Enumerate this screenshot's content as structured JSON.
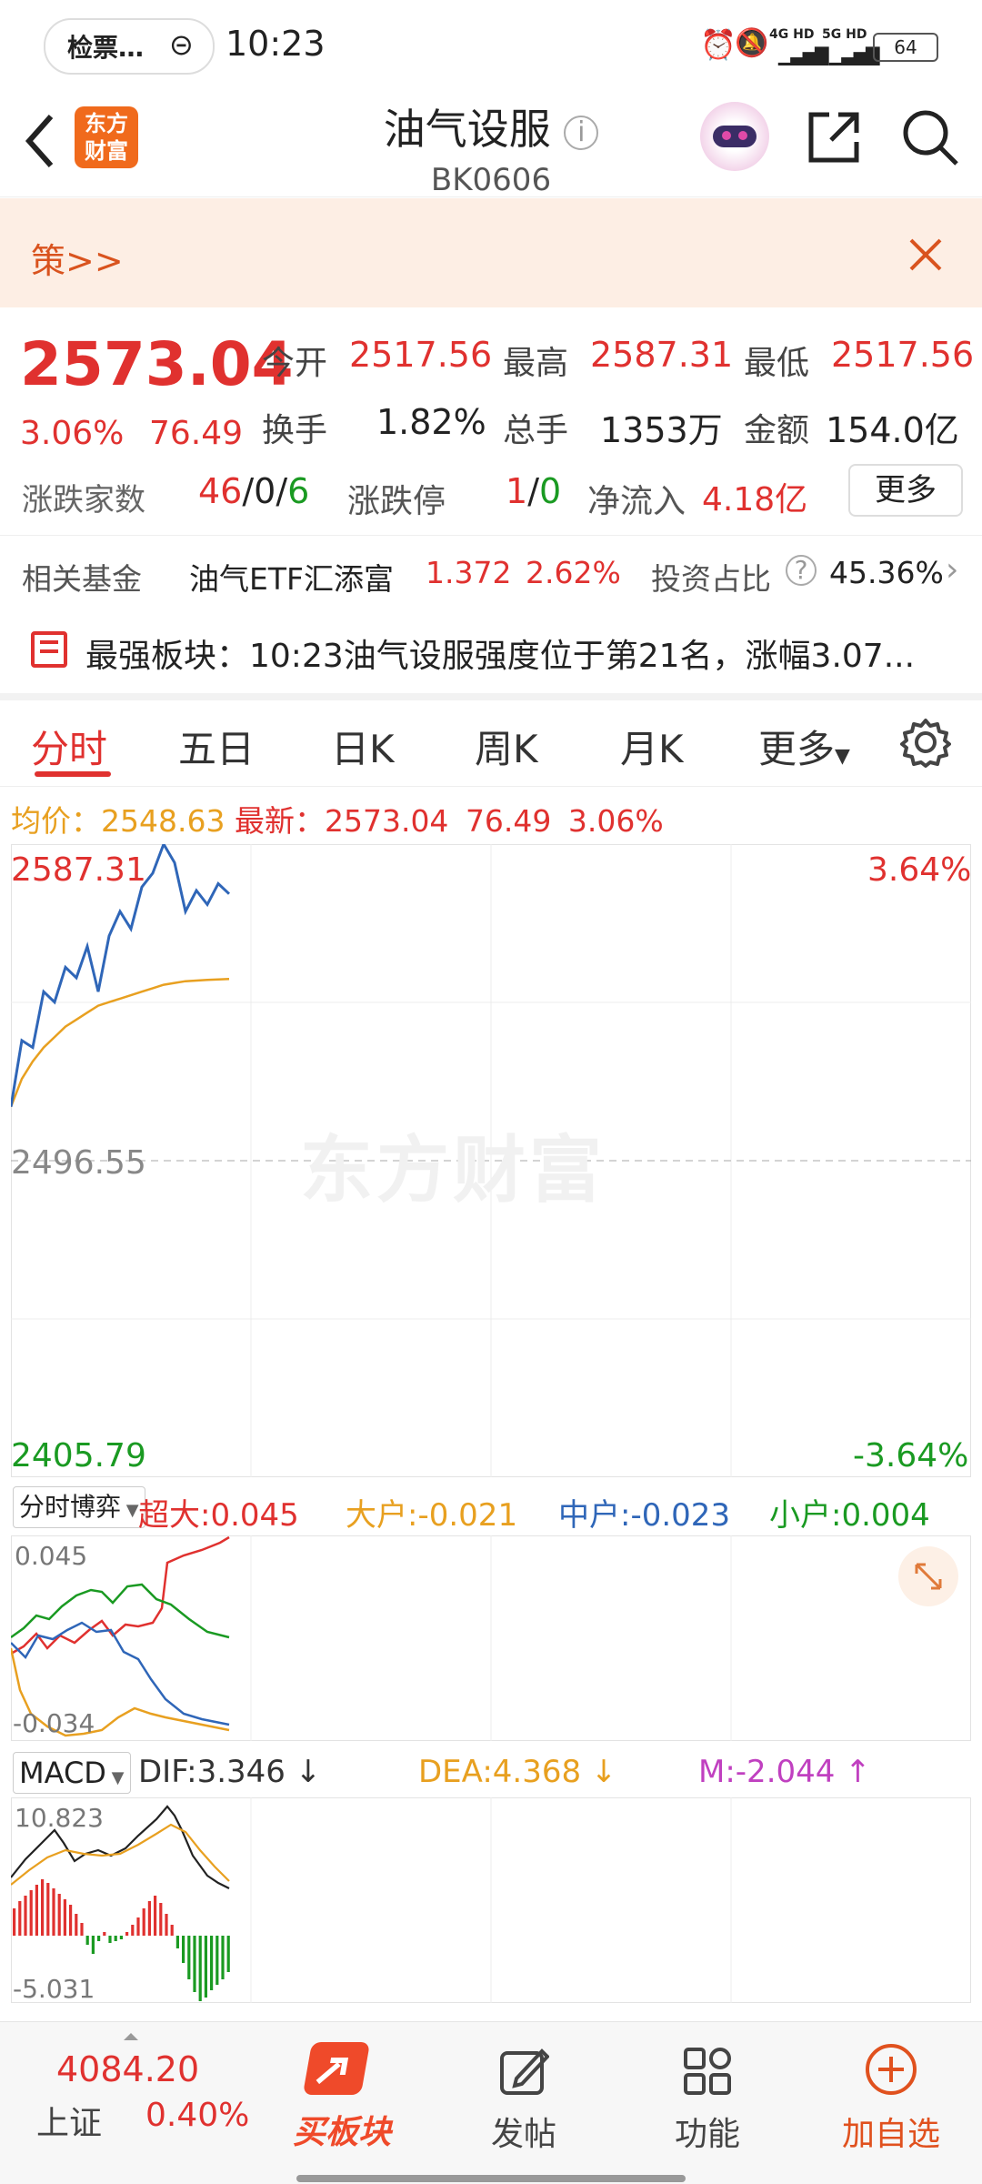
{
  "status_bar": {
    "notif_text": "检票…",
    "time": "10:23",
    "signal1": "4G HD",
    "signal2": "5G HD",
    "battery": "64"
  },
  "header": {
    "logo_line1": "东方",
    "logo_line2": "财富",
    "title": "油气设服",
    "code": "BK0606"
  },
  "banner": {
    "text": "策>>"
  },
  "quote": {
    "price": "2573.04",
    "change_pct": "3.06%",
    "change": "76.49",
    "open_label": "今开",
    "open": "2517.56",
    "high_label": "最高",
    "high": "2587.31",
    "low_label": "最低",
    "low": "2517.56",
    "turnover_label": "换手",
    "turnover": "1.82%",
    "volume_label": "总手",
    "volume": "1353万",
    "amount_label": "金额",
    "amount": "154.0亿",
    "updown_label": "涨跌家数",
    "up": "46",
    "flat": "0",
    "down": "6",
    "sep": "/",
    "limit_label": "涨跌停",
    "limit_up": "1",
    "limit_down": "0",
    "netflow_label": "净流入",
    "netflow": "4.18亿",
    "more_button": "更多"
  },
  "fund": {
    "label": "相关基金",
    "name": "油气ETF汇添富",
    "price": "1.372",
    "pct": "2.62%",
    "ratio_label": "投资占比",
    "ratio": "45.36%"
  },
  "strongest": {
    "text": "最强板块：10:23油气设服强度位于第21名，涨幅3.07..."
  },
  "tabs": [
    "分时",
    "五日",
    "日K",
    "周K",
    "月K",
    "更多"
  ],
  "info_line": {
    "avg_label": "均价：",
    "avg": "2548.63",
    "latest_label": "最新：",
    "latest": "2573.04",
    "change": "76.49",
    "pct": "3.06%"
  },
  "chart_labels": {
    "max": "2587.31",
    "max_pct": "3.64%",
    "mid": "2496.55",
    "min": "2405.79",
    "min_pct": "-3.64%",
    "watermark": "东方财富"
  },
  "fund_flow": {
    "selector": "分时博弈",
    "super_label": "超大:",
    "super": "0.045",
    "large_label": "大户:",
    "large": "-0.021",
    "mid_label": "中户:",
    "mid": "-0.023",
    "small_label": "小户:",
    "small": "0.004",
    "max": "0.045",
    "min": "-0.034"
  },
  "macd": {
    "selector": "MACD",
    "dif": "DIF:3.346 ↓",
    "dea": "DEA:4.368 ↓",
    "m": "M:-2.044 ↑",
    "max": "10.823",
    "min": "-5.031"
  },
  "bottom_bar": {
    "index_value": "4084.20",
    "index_name": "上证",
    "index_pct": "0.40%",
    "buy_label": "买板块",
    "post_label": "发帖",
    "func_label": "功能",
    "add_label": "加自选"
  },
  "colors": {
    "red": "#e0312f",
    "green": "#1a9a22",
    "price_line": "#2f66b8",
    "avg_line": "#e8a020",
    "accent": "#f06a1c"
  },
  "chart_data": {
    "type": "line",
    "series": [
      {
        "values": [
          2512,
          2531,
          2529,
          2545,
          2542,
          2552,
          2549,
          2558,
          2545,
          2561,
          2568,
          2563,
          2575,
          2579,
          2587.31,
          2582,
          2568,
          2574,
          2570,
          2576,
          2573.04
        ]
      },
      {
        "values": [
          2512,
          2520,
          2525,
          2529,
          2532,
          2535,
          2537,
          2539,
          2541,
          2542,
          2543,
          2544,
          2545,
          2546,
          2547,
          2547.5,
          2548,
          2548.2,
          2548.4,
          2548.5,
          2548.63
        ]
      }
    ],
    "ylim": [
      2405.79,
      2587.31
    ],
    "y_ticks": [
      "2587.31",
      "2496.55",
      "2405.79"
    ]
  }
}
